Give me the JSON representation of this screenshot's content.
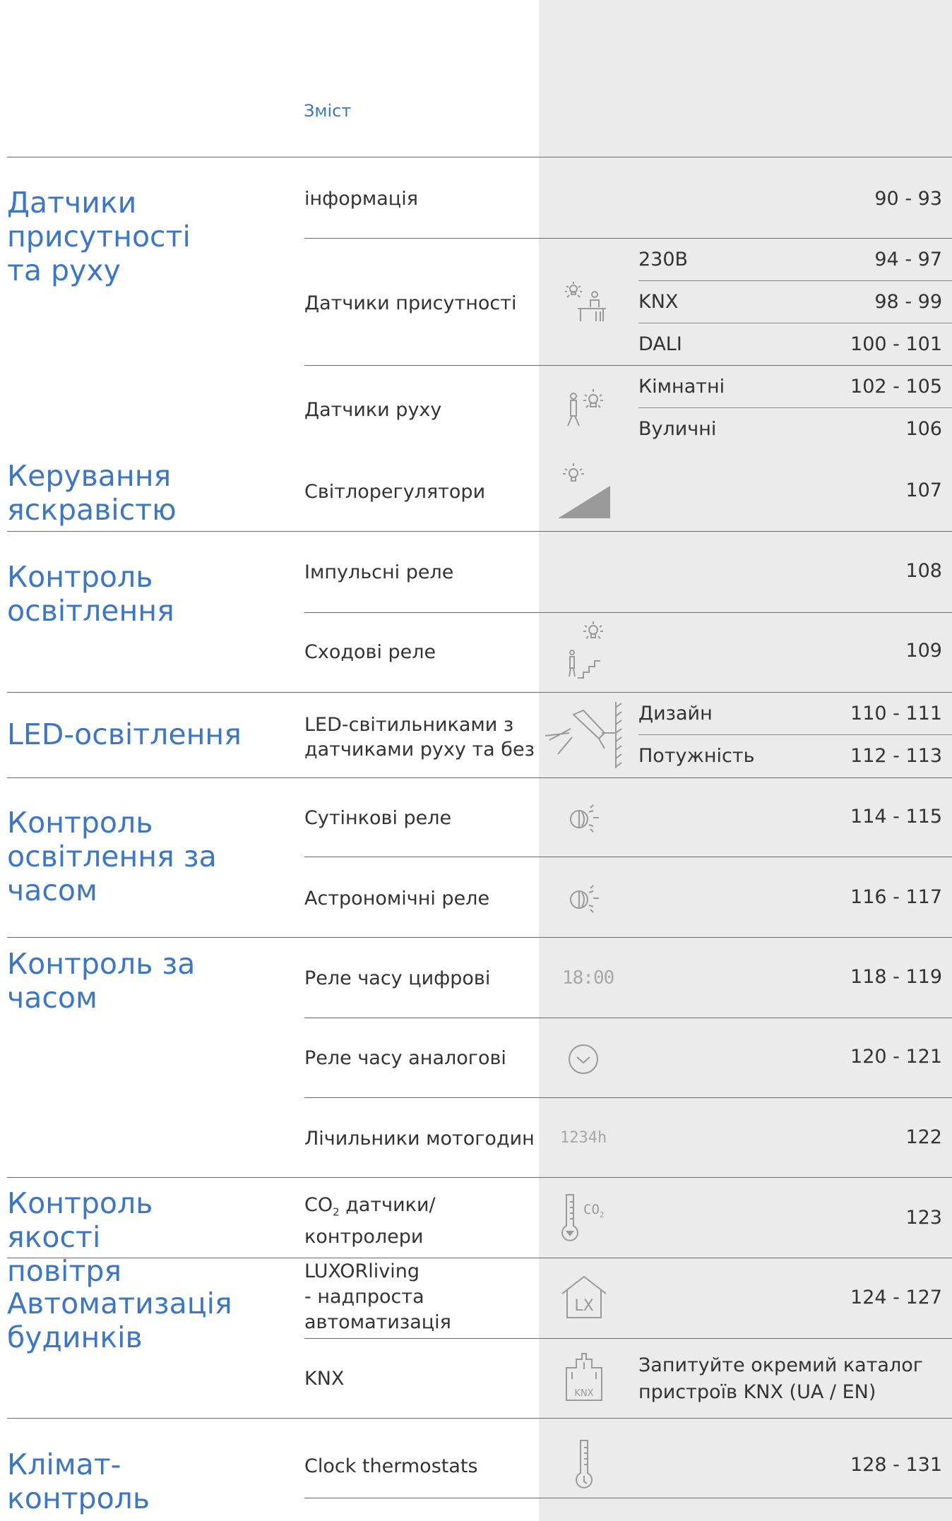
{
  "header": "Зміст",
  "categories": [
    "Датчики присутності та руху",
    "Керування яскравістю",
    "Контроль освітлення",
    "LED-освітлення",
    "Контроль освітлення за часом",
    "Контроль за часом",
    "Контроль якості повітря",
    "Автоматизація будинків",
    "Клімат-контроль"
  ],
  "rows": {
    "info": {
      "label": "інформація",
      "pages": "90 - 93"
    },
    "presence": {
      "label": "Датчики присутності",
      "subs": [
        {
          "label": "230В",
          "pages": "94 -  97"
        },
        {
          "label": "KNX",
          "pages": "98 - 99"
        },
        {
          "label": "DALI",
          "pages": "100 - 101"
        }
      ]
    },
    "motion": {
      "label": "Датчики руху",
      "subs": [
        {
          "label": "Кімнатні",
          "pages": "102 - 105"
        },
        {
          "label": "Вуличні",
          "pages": "106"
        }
      ]
    },
    "dimmers": {
      "label": "Світлорегулятори",
      "pages": "107"
    },
    "impulse": {
      "label": "Імпульсні реле",
      "pages": "108"
    },
    "stair": {
      "label": "Сходові реле",
      "pages": "109"
    },
    "led": {
      "label1": "LED-світильниками з",
      "label2": "датчиками руху та без",
      "subs": [
        {
          "label": "Дизайн",
          "pages": "110 - 111"
        },
        {
          "label": "Потужність",
          "pages": "112 - 113"
        }
      ]
    },
    "twilight": {
      "label": "Сутінкові реле",
      "pages": "114 - 115"
    },
    "astro": {
      "label": "Астрономічні реле",
      "pages": "116 - 117"
    },
    "digital": {
      "label": "Реле часу цифрові",
      "pages": "118 - 119",
      "icon_text": "18:00"
    },
    "analog": {
      "label": "Реле часу аналогові",
      "pages": "120 - 121"
    },
    "hours": {
      "label": "Лічильники мотогодин",
      "pages": "122",
      "icon_text": "1234h"
    },
    "co2": {
      "label_pre": "CO",
      "label_sub": "2",
      "label_post": " датчики/",
      "label2": "контролери",
      "pages": "123",
      "icon_text": "CO",
      "icon_sub": "2"
    },
    "luxor": {
      "label1": "LUXORliving",
      "label2": "- надпроста",
      "label3": "автоматизація",
      "pages": "124 - 127",
      "icon_text": "LX"
    },
    "knx": {
      "label": "KNX",
      "note1": "Запитуйте окремий каталог",
      "note2": "пристроїв KNX (UA / EN)",
      "icon_text": "KNX"
    },
    "clock": {
      "label": "Clock thermostats",
      "pages": "128 - 131"
    }
  },
  "icons": [
    "presence-icon",
    "motion-icon",
    "dimmer-icon",
    "stair-icon",
    "led-icon",
    "twilight-icon",
    "astro-icon",
    "digital-clock-icon",
    "analog-clock-icon",
    "hour-counter-icon",
    "co2-icon",
    "house-lx-icon",
    "knx-building-icon",
    "thermometer-icon"
  ],
  "colors": {
    "accent": "#3d77c2",
    "column_bg": "#ebebeb",
    "icon": "#9a9a9a"
  }
}
